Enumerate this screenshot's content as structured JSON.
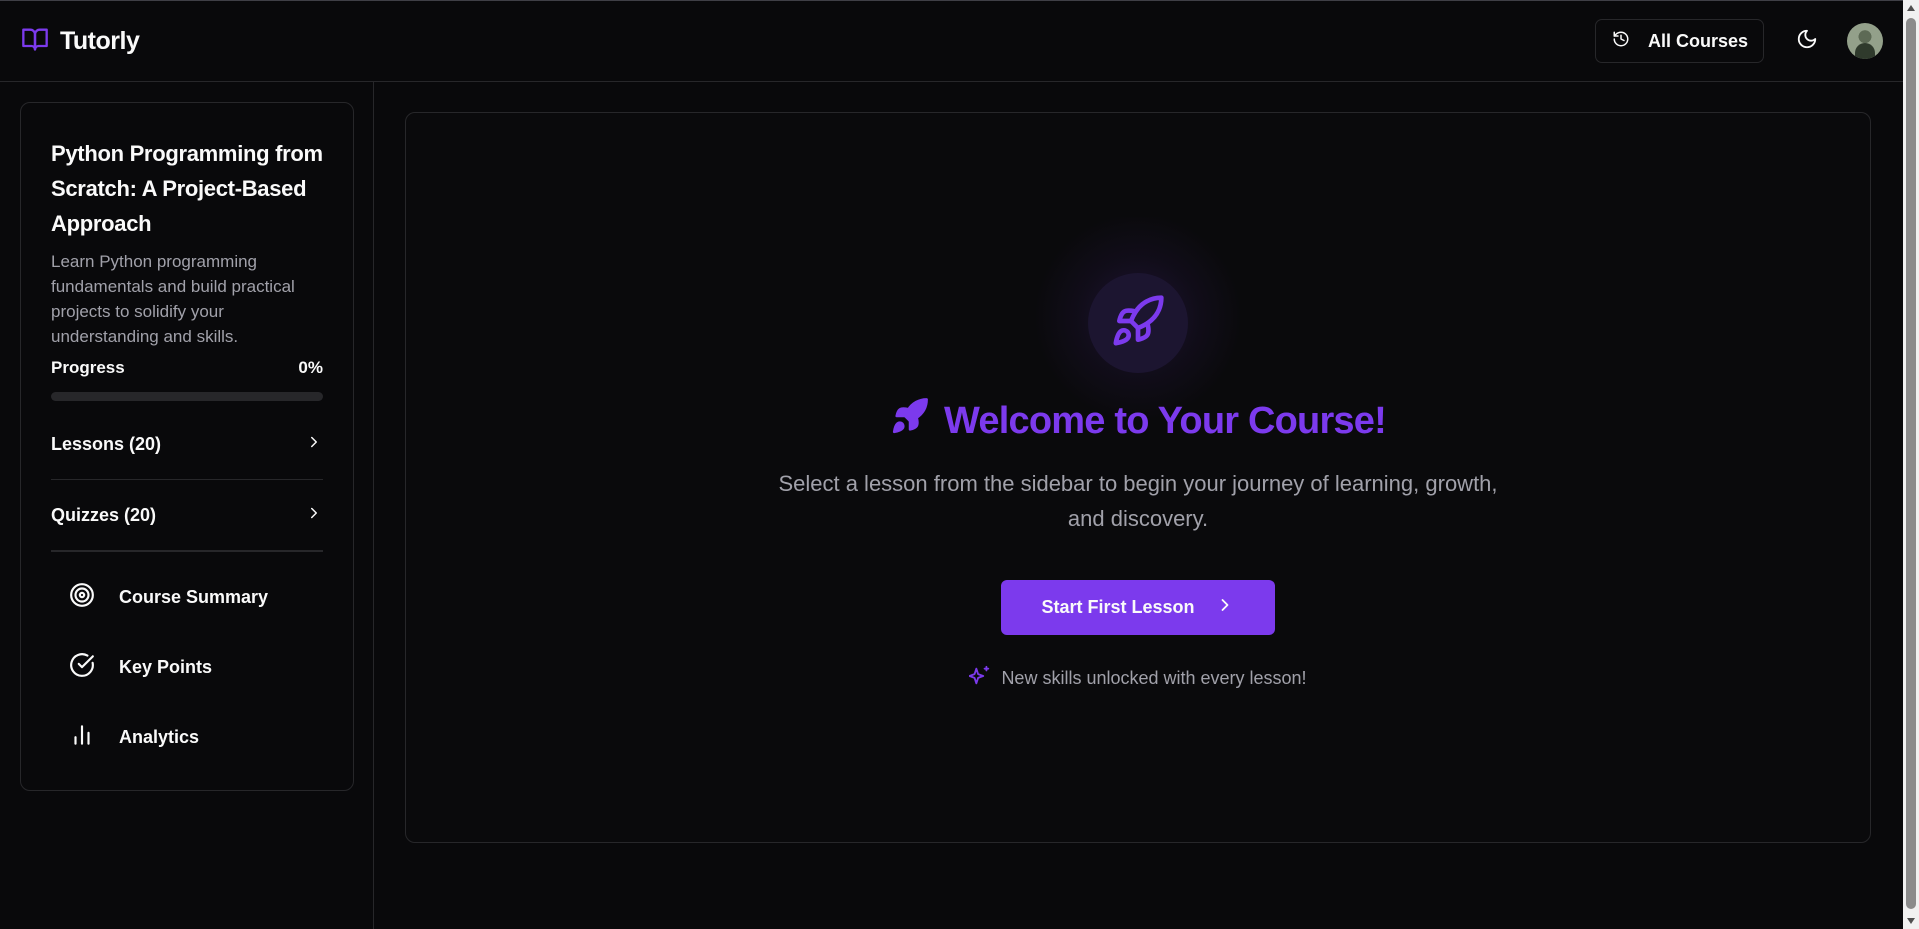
{
  "header": {
    "brand_name": "Tutorly",
    "brand_icon": "book-open-icon",
    "all_courses_label": "All Courses",
    "all_courses_icon": "history-icon",
    "theme_icon": "moon-icon"
  },
  "sidebar": {
    "course_title": "Python Programming from Scratch: A Project-Based Approach",
    "course_description": "Learn Python programming fundamentals and build practical projects to solidify your understanding and skills.",
    "progress_label": "Progress",
    "progress_value": "0%",
    "progress_fraction": 0,
    "sections": [
      {
        "label": "Lessons (20)",
        "icon": "chevron-right-icon"
      },
      {
        "label": "Quizzes (20)",
        "icon": "chevron-right-icon"
      }
    ],
    "nav_items": [
      {
        "label": "Course Summary",
        "icon": "target-icon"
      },
      {
        "label": "Key Points",
        "icon": "check-circle-icon"
      },
      {
        "label": "Analytics",
        "icon": "bar-chart-icon"
      }
    ]
  },
  "main": {
    "hero_icon": "rocket-icon",
    "title": "Welcome to Your Course!",
    "subtitle": "Select a lesson from the sidebar to begin your journey of learning, growth, and discovery.",
    "start_button_label": "Start First Lesson",
    "tagline": "New skills unlocked with every lesson!",
    "tagline_icon": "sparkles-icon"
  },
  "colors": {
    "accent": "#7c3aed",
    "background": "#09090b",
    "border": "#27272a",
    "muted_text": "#a1a1aa"
  }
}
